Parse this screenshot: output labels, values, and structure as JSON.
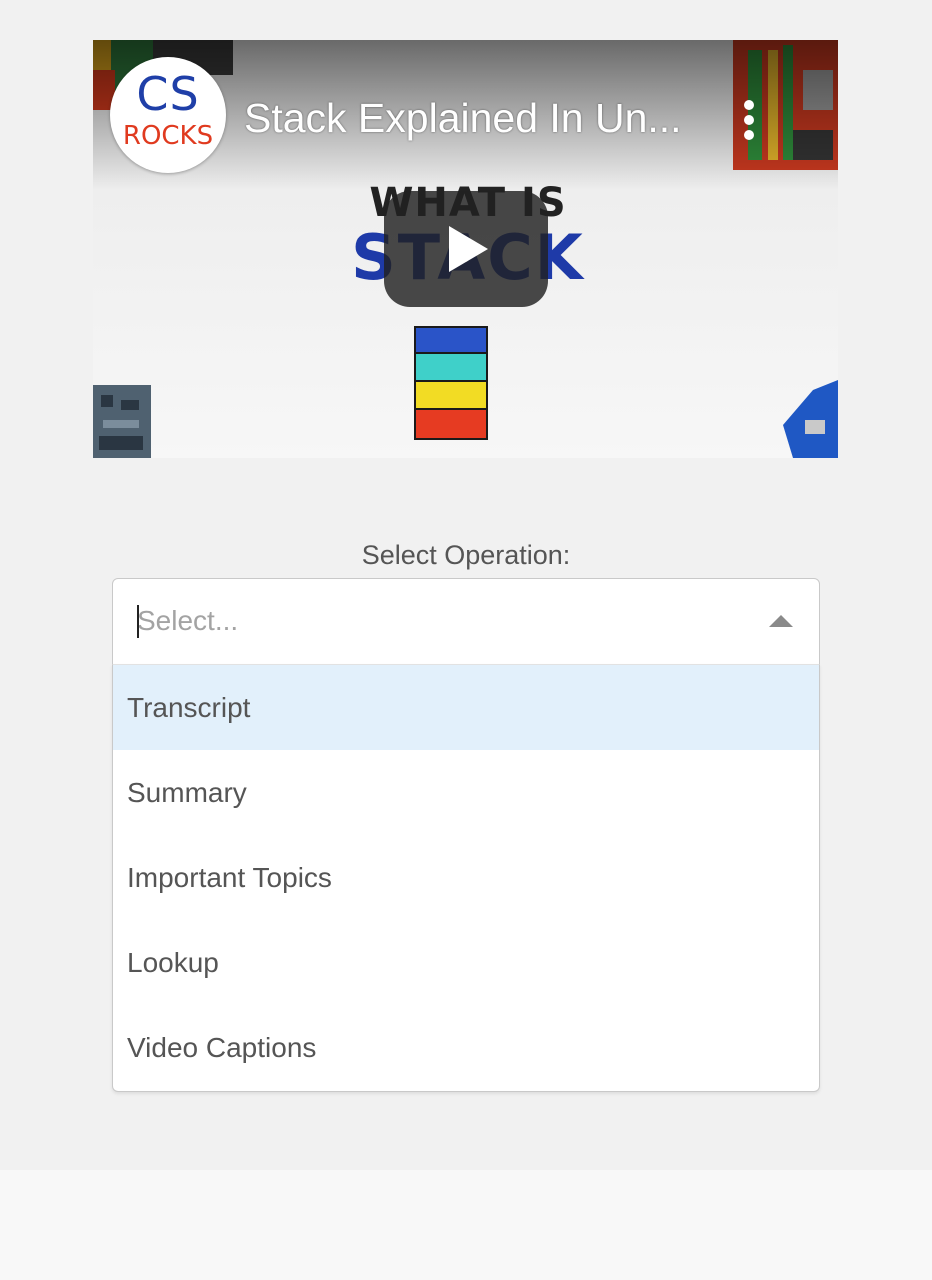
{
  "video": {
    "channel_logo": {
      "line1": "CS",
      "line2": "ROCKS"
    },
    "title": "Stack Explained In Un...",
    "thumbnail_text": {
      "line1": "WHAT IS",
      "line2": "STACK"
    },
    "play_icon": "play-icon",
    "more_icon": "vertical-dots-icon"
  },
  "form": {
    "label": "Select Operation:",
    "select": {
      "placeholder": "Select...",
      "value": "",
      "expanded": true,
      "arrow_icon": "caret-up-icon"
    },
    "options": [
      {
        "label": "Transcript",
        "focused": true
      },
      {
        "label": "Summary",
        "focused": false
      },
      {
        "label": "Important Topics",
        "focused": false
      },
      {
        "label": "Lookup",
        "focused": false
      },
      {
        "label": "Video Captions",
        "focused": false
      }
    ]
  },
  "colors": {
    "page_background": "#f1f1f1",
    "focused_option": "#e2f0fb",
    "text": "#555555",
    "placeholder": "#a3a3a3",
    "border": "#c9c9c9"
  }
}
